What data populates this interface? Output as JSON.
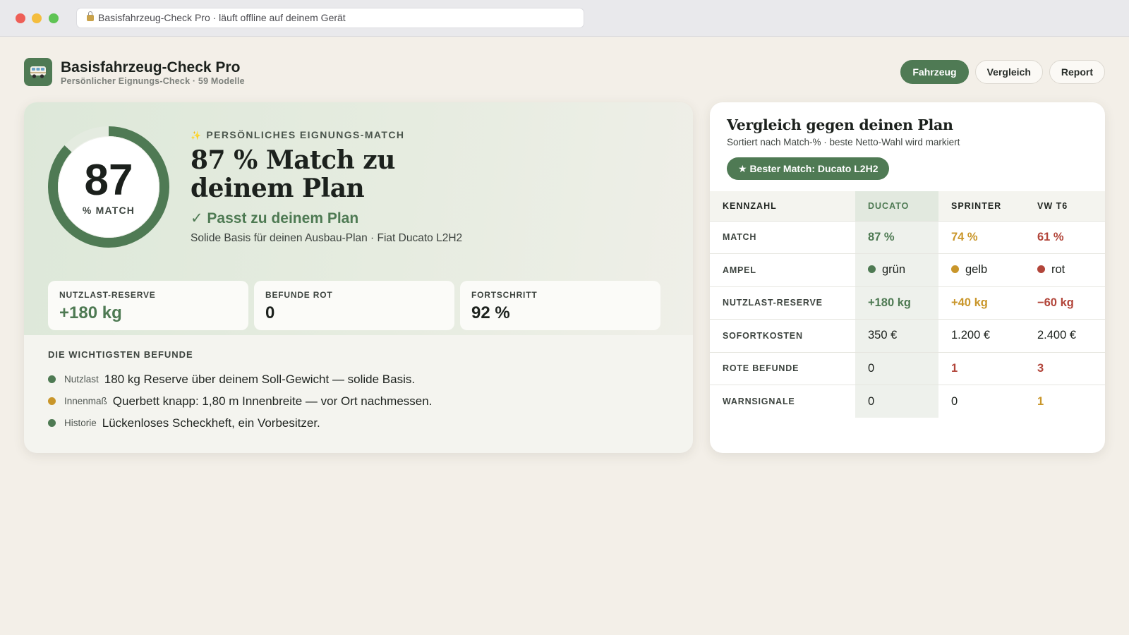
{
  "browser": {
    "url_text": "Basisfahrzeug-Check Pro · läuft offline auf deinem Gerät"
  },
  "app": {
    "title": "Basisfahrzeug-Check Pro",
    "subtitle": "Persönlicher Eignungs-Check · 59 Modelle",
    "logo_icon": "van-icon",
    "nav": [
      {
        "label": "Fahrzeug",
        "active": true
      },
      {
        "label": "Vergleich",
        "active": false
      },
      {
        "label": "Report",
        "active": false
      }
    ]
  },
  "score": {
    "value": "87",
    "label": "% MATCH",
    "fraction": 0.87,
    "eyebrow": "PERSÖNLICHES EIGNUNGS-MATCH",
    "headline": "87 % Match zu deinem Plan",
    "verdict": "✓ Passt zu deinem Plan",
    "verdict_sub": "Solide Basis für deinen Ausbau-Plan · Fiat Ducato L2H2"
  },
  "kpis": [
    {
      "label": "NUTZLAST-RESERVE",
      "value": "+180 kg",
      "tone": "green"
    },
    {
      "label": "BEFUNDE ROT",
      "value": "0",
      "tone": "dark"
    },
    {
      "label": "FORTSCHRITT",
      "value": "92 %",
      "tone": "dark"
    }
  ],
  "findings": {
    "title": "DIE WICHTIGSTEN BEFUNDE",
    "items": [
      {
        "status": "green",
        "category": "Nutzlast",
        "text": "180 kg Reserve über deinem Soll-Gewicht — solide Basis."
      },
      {
        "status": "amber",
        "category": "Innenmaß",
        "text": "Querbett knapp: 1,80 m Innenbreite — vor Ort nachmessen."
      },
      {
        "status": "green",
        "category": "Historie",
        "text": "Lückenloses Scheckheft, ein Vorbesitzer."
      }
    ]
  },
  "comparison": {
    "title": "Vergleich gegen deinen Plan",
    "subtitle": "Sortiert nach Match-% · beste Netto-Wahl wird markiert",
    "best_badge": "★ Bester Match: Ducato L2H2",
    "headers": [
      "KENNZAHL",
      "DUCATO",
      "SPRINTER",
      "VW T6"
    ],
    "rows": [
      {
        "label": "MATCH",
        "values": [
          {
            "text": "87 %",
            "tone": "green",
            "bold": true
          },
          {
            "text": "74 %",
            "tone": "amber",
            "bold": true
          },
          {
            "text": "61 %",
            "tone": "red",
            "bold": true
          }
        ]
      },
      {
        "label": "AMPEL",
        "values": [
          {
            "text": "grün",
            "dot": "green"
          },
          {
            "text": "gelb",
            "dot": "amber"
          },
          {
            "text": "rot",
            "dot": "red"
          }
        ]
      },
      {
        "label": "NUTZLAST-RESERVE",
        "values": [
          {
            "text": "+180 kg",
            "tone": "green",
            "bold": true
          },
          {
            "text": "+40 kg",
            "tone": "amber",
            "bold": true
          },
          {
            "text": "−60 kg",
            "tone": "red",
            "bold": true
          }
        ]
      },
      {
        "label": "SOFORTKOSTEN",
        "values": [
          {
            "text": "350 €"
          },
          {
            "text": "1.200 €"
          },
          {
            "text": "2.400 €"
          }
        ]
      },
      {
        "label": "ROTE BEFUNDE",
        "values": [
          {
            "text": "0"
          },
          {
            "text": "1",
            "tone": "red",
            "bold": true
          },
          {
            "text": "3",
            "tone": "red",
            "bold": true
          }
        ]
      },
      {
        "label": "WARNSIGNALE",
        "values": [
          {
            "text": "0"
          },
          {
            "text": "0"
          },
          {
            "text": "1",
            "tone": "amber",
            "bold": true
          }
        ]
      }
    ]
  },
  "colors": {
    "accent": "#4f7a54",
    "green": "#4e7a53",
    "amber": "#c9962a",
    "red": "#b2453a",
    "background": "#f3efe8"
  }
}
